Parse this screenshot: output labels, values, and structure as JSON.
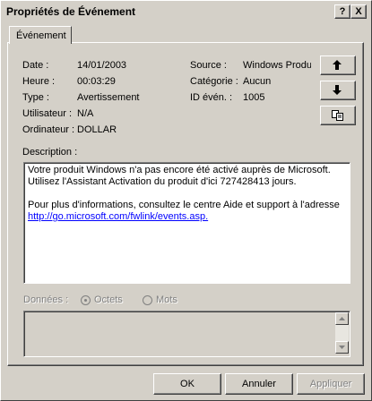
{
  "window": {
    "title": "Propriétés de Événement"
  },
  "titlebar_buttons": {
    "help": "?",
    "close": "X"
  },
  "tab": {
    "label": "Événement"
  },
  "fields_left": [
    {
      "label": "Date :",
      "value": "14/01/2003"
    },
    {
      "label": "Heure :",
      "value": "00:03:29"
    },
    {
      "label": "Type :",
      "value": "Avertissement"
    },
    {
      "label": "Utilisateur :",
      "value": "N/A"
    },
    {
      "label": "Ordinateur :",
      "value": "DOLLAR"
    }
  ],
  "fields_right": [
    {
      "label": "Source :",
      "value": "Windows Produ"
    },
    {
      "label": "Catégorie :",
      "value": "Aucun"
    },
    {
      "label": "ID évén. :",
      "value": "1005"
    }
  ],
  "description": {
    "label": "Description :",
    "line1": "Votre produit Windows n'a pas encore été activé auprès de Microsoft.",
    "line2": "Utilisez l'Assistant Activation du produit d'ici 727428413 jours.",
    "line3": "Pour plus d'informations, consultez le centre Aide et support à l'adresse",
    "link": "http://go.microsoft.com/fwlink/events.asp."
  },
  "data_section": {
    "label": "Données :",
    "option_bytes": "Octets",
    "option_words": "Mots",
    "selected": "Octets"
  },
  "icons": {
    "up": "arrow-up-icon",
    "down": "arrow-down-icon",
    "copy": "copy-icon"
  },
  "buttons": {
    "ok": "OK",
    "cancel": "Annuler",
    "apply": "Appliquer"
  }
}
